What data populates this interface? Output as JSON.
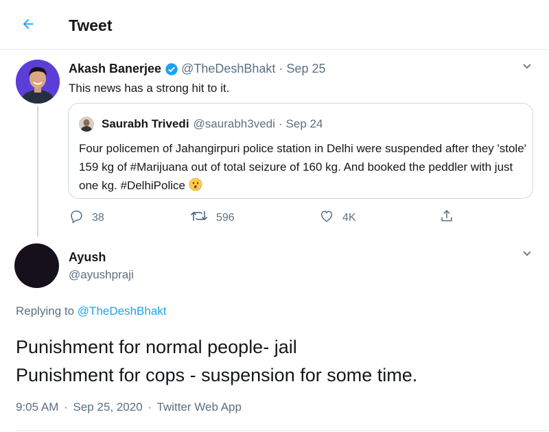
{
  "header": {
    "title": "Tweet",
    "back_icon": "arrow-left-icon"
  },
  "colors": {
    "accent": "#1da1f2",
    "secondary_text": "#5b7083",
    "verified": "#1da1f2",
    "border": "#cfd9de"
  },
  "parent_tweet": {
    "author_name": "Akash Banerjee",
    "verified": true,
    "handle": "@TheDeshBhakt",
    "separator": "·",
    "date": "Sep 25",
    "text": "This news has a strong hit to it.",
    "quoted": {
      "author_name": "Saurabh Trivedi",
      "handle": "@saurabh3vedi",
      "separator": "·",
      "date": "Sep 24",
      "text": "Four policemen of Jahangirpuri police station in Delhi were suspended after they 'stole' 159 kg of #Marijuana out of total seizure of 160 kg. And booked the peddler with just one kg. #DelhiPolice"
    },
    "actions": {
      "replies": "38",
      "retweets": "596",
      "likes": "4K"
    }
  },
  "main_tweet": {
    "author_name": "Ayush",
    "handle": "@ayushpraji",
    "replying_prefix": "Replying to",
    "replying_to": "@TheDeshBhakt",
    "line1": "Punishment for normal people- jail",
    "line2": "Punishment for cops - suspension for some time.",
    "time": "9:05 AM",
    "separator": "·",
    "date": "Sep 25, 2020",
    "separator2": "·",
    "source": "Twitter Web App"
  }
}
